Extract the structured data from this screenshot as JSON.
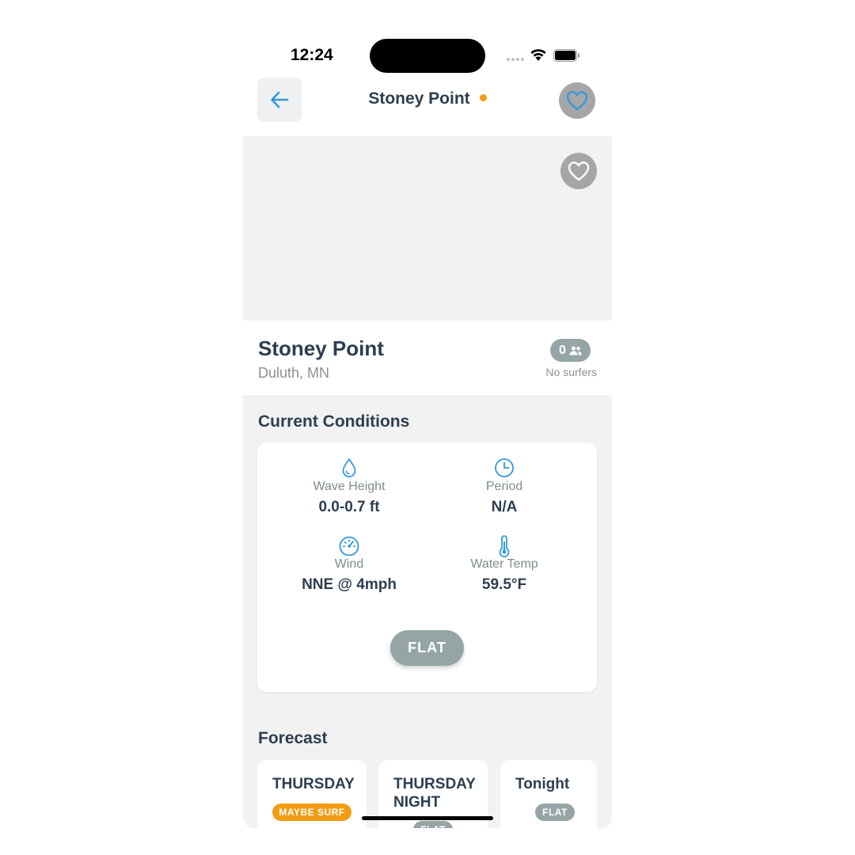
{
  "status_bar": {
    "time": "12:24"
  },
  "nav": {
    "title": "Stoney Point",
    "status_dot_color": "#f39c12"
  },
  "spot": {
    "name": "Stoney Point",
    "location": "Duluth, MN",
    "surfer_count": "0",
    "surfer_label": "No surfers"
  },
  "conditions": {
    "title": "Current Conditions",
    "metrics": [
      {
        "icon": "droplet-icon",
        "label": "Wave Height",
        "value": "0.0-0.7 ft"
      },
      {
        "icon": "clock-icon",
        "label": "Period",
        "value": "N/A"
      },
      {
        "icon": "speedometer-icon",
        "label": "Wind",
        "value": "NNE @ 4mph"
      },
      {
        "icon": "thermometer-icon",
        "label": "Water Temp",
        "value": "59.5°F"
      }
    ],
    "rating": "FLAT"
  },
  "forecast": {
    "title": "Forecast",
    "cards": [
      {
        "day": "THURSDAY",
        "tag": "MAYBE SURF",
        "tag_color": "#f39c12"
      },
      {
        "day": "THURSDAY NIGHT",
        "tag": "FLAT",
        "tag_color": "#95a5a6"
      },
      {
        "day": "Tonight",
        "tag": "FLAT",
        "tag_color": "#95a5a6"
      }
    ]
  },
  "colors": {
    "accent": "#3498db",
    "text": "#2d3e50",
    "muted": "#8a8f94",
    "flat": "#95a5a6",
    "maybe": "#f39c12"
  }
}
